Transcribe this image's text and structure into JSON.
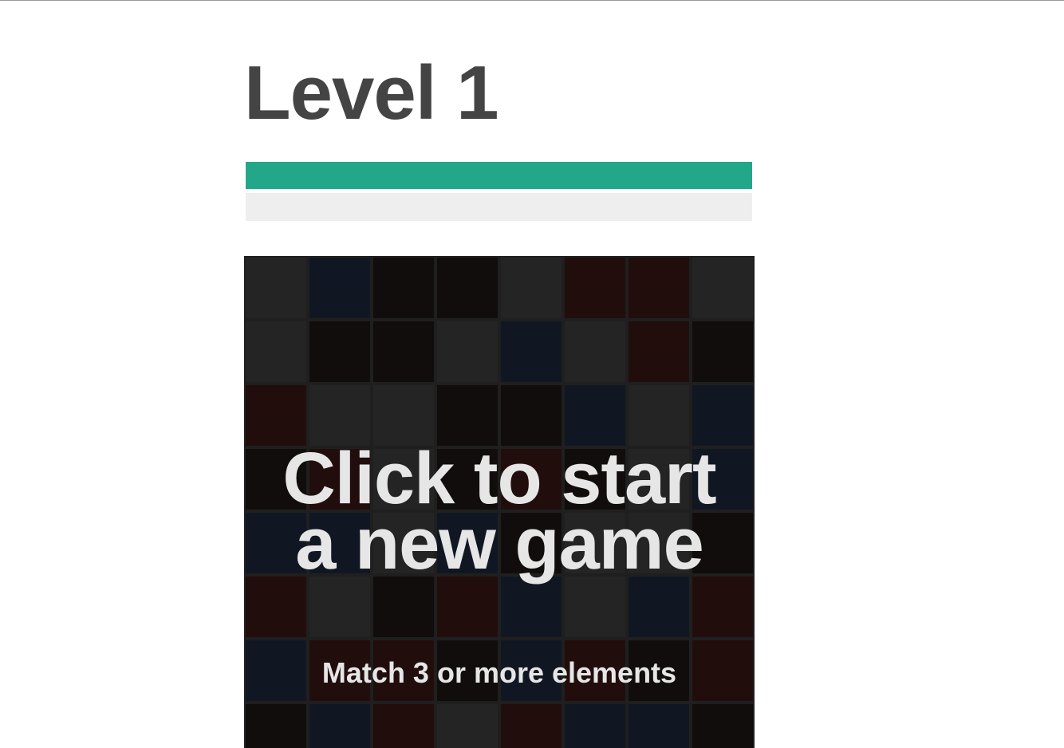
{
  "level": {
    "title": "Level 1"
  },
  "progress": {
    "primary_fraction": 1.0,
    "secondary_fraction": 0.0,
    "fill_color": "#22a888",
    "track_color": "#eeeeee"
  },
  "board": {
    "rows": 8,
    "cols": 8,
    "palette": {
      "gray": "#242424",
      "black": "#110d0c",
      "navy": "#111722",
      "maroon": "#220d0d"
    },
    "cells": [
      [
        "gray",
        "navy",
        "black",
        "black",
        "gray",
        "maroon",
        "maroon",
        "gray"
      ],
      [
        "gray",
        "black",
        "black",
        "gray",
        "navy",
        "gray",
        "maroon",
        "black"
      ],
      [
        "maroon",
        "gray",
        "gray",
        "black",
        "black",
        "navy",
        "gray",
        "navy"
      ],
      [
        "black",
        "maroon",
        "gray",
        "black",
        "maroon",
        "black",
        "gray",
        "navy"
      ],
      [
        "navy",
        "navy",
        "gray",
        "navy",
        "black",
        "gray",
        "gray",
        "black"
      ],
      [
        "maroon",
        "gray",
        "black",
        "maroon",
        "navy",
        "gray",
        "navy",
        "maroon"
      ],
      [
        "navy",
        "maroon",
        "maroon",
        "black",
        "navy",
        "maroon",
        "black",
        "maroon"
      ],
      [
        "black",
        "navy",
        "maroon",
        "gray",
        "maroon",
        "navy",
        "navy",
        "black"
      ]
    ]
  },
  "overlay": {
    "start_line_1": "Click to start",
    "start_line_2": "a new game",
    "hint": "Match 3 or more elements"
  }
}
